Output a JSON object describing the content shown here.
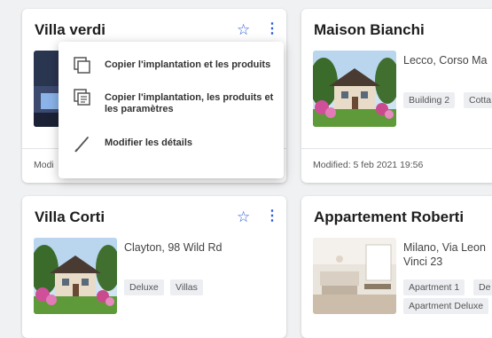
{
  "cards": [
    {
      "title": "Villa verdi",
      "modified": "Modi"
    },
    {
      "title": "Maison Bianchi",
      "address": "Lecco, Corso Ma",
      "tags": [
        "Building 2",
        "Cotta"
      ],
      "modified": "Modified: 5 feb 2021 19:56"
    },
    {
      "title": "Villa Corti",
      "address": "Clayton, 98 Wild Rd",
      "tags": [
        "Deluxe",
        "Villas"
      ]
    },
    {
      "title": "Appartement Roberti",
      "address_line1": "Milano, Via Leon",
      "address_line2": "Vinci 23",
      "tags": [
        "Apartment 1",
        "De",
        "Apartment Deluxe"
      ]
    }
  ],
  "context_menu": {
    "items": [
      {
        "label": "Copier l'implantation et les produits",
        "icon": "copy-icon"
      },
      {
        "label": "Copier l'implantation, les produits et les paramètres",
        "icon": "copy-settings-icon"
      },
      {
        "label": "Modifier les détails",
        "icon": "edit-pencil-icon"
      }
    ]
  },
  "icons": {
    "star": "☆",
    "more": "⋮"
  },
  "colors": {
    "accent": "#2d5ed8",
    "background": "#f0f1f3",
    "card": "#ffffff",
    "tag_bg": "#eceef1"
  }
}
